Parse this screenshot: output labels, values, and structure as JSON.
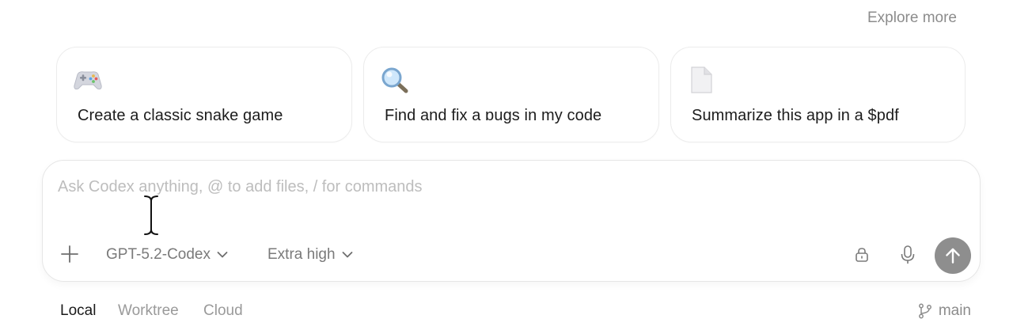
{
  "header": {
    "explore_label": "Explore more"
  },
  "suggestions": [
    {
      "label": "Create a classic snake game",
      "icon": "gamepad-icon"
    },
    {
      "label": "Find and fix a ɒugs in my code",
      "icon": "magnifier-icon"
    },
    {
      "label": "Summarize this app in a $pdf",
      "icon": "document-icon"
    }
  ],
  "composer": {
    "placeholder": "Ask Codex anything, @ to add files, / for commands",
    "value": "",
    "model": "GPT-5.2-Codex",
    "effort": "Extra high",
    "icons": [
      "plus-icon",
      "chevron-down-icon",
      "lock-icon",
      "microphone-icon",
      "arrow-up-icon"
    ]
  },
  "environment": {
    "tabs": [
      "Local",
      "Worktree",
      "Cloud"
    ],
    "active": "Local",
    "branch": "main"
  },
  "colors": {
    "send_button": "#8e8e8e",
    "placeholder": "#bdbdbd",
    "muted_text": "#8c8c8c",
    "card_border": "#ececec"
  }
}
